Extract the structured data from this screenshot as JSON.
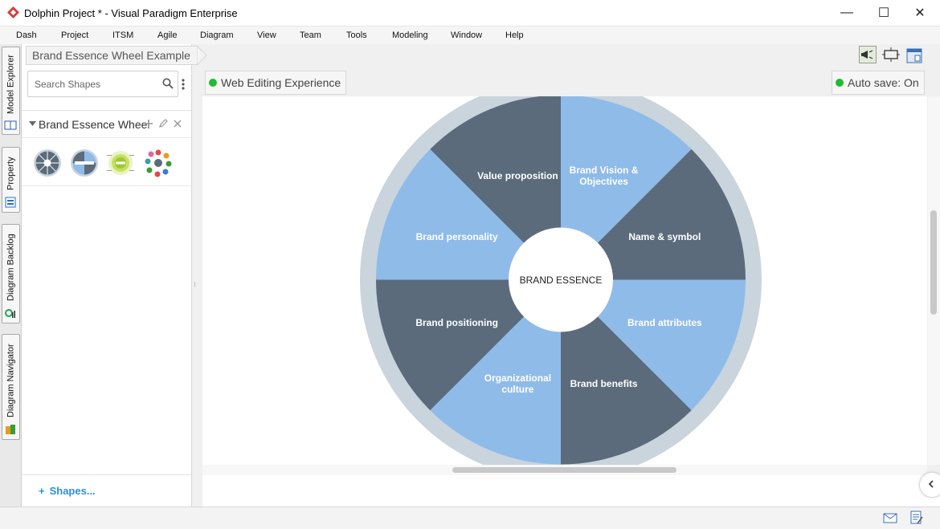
{
  "window": {
    "title": "Dolphin Project * - Visual Paradigm Enterprise",
    "minimize_glyph": "—",
    "maximize_glyph": "☐",
    "close_glyph": "✕"
  },
  "menu": [
    "Dash",
    "Project",
    "ITSM",
    "Agile",
    "Diagram",
    "View",
    "Team",
    "Tools",
    "Modeling",
    "Window",
    "Help"
  ],
  "left_tabs": [
    "Model Explorer",
    "Property",
    "Diagram Backlog",
    "Diagram Navigator"
  ],
  "breadcrumb": "Brand Essence Wheel Example",
  "search": {
    "placeholder": "Search Shapes"
  },
  "shape_group": {
    "title": "Brand Essence Wheel"
  },
  "shapes_link": "Shapes...",
  "badges": {
    "web_editing": "Web Editing Experience",
    "auto_save": "Auto save: On"
  },
  "diagram": {
    "center_label": "BRAND ESSENCE",
    "segments": [
      {
        "label_lines": [
          "Brand Vision &",
          "Objectives"
        ],
        "style": "light"
      },
      {
        "label_lines": [
          "Name & symbol"
        ],
        "style": "dark"
      },
      {
        "label_lines": [
          "Brand attributes"
        ],
        "style": "light"
      },
      {
        "label_lines": [
          "Brand benefits"
        ],
        "style": "dark"
      },
      {
        "label_lines": [
          "Organizational",
          "culture"
        ],
        "style": "light"
      },
      {
        "label_lines": [
          "Brand positioning"
        ],
        "style": "dark"
      },
      {
        "label_lines": [
          "Brand personality"
        ],
        "style": "light"
      },
      {
        "label_lines": [
          "Value proposition"
        ],
        "style": "dark"
      }
    ]
  },
  "colors": {
    "segment_dark": "#5b6b7c",
    "segment_light": "#8fbbe9",
    "ring": "#c9d4dd",
    "accent_blue": "#2b8fe0",
    "status_green": "#22bb33",
    "logo_red": "#d83b3b"
  }
}
